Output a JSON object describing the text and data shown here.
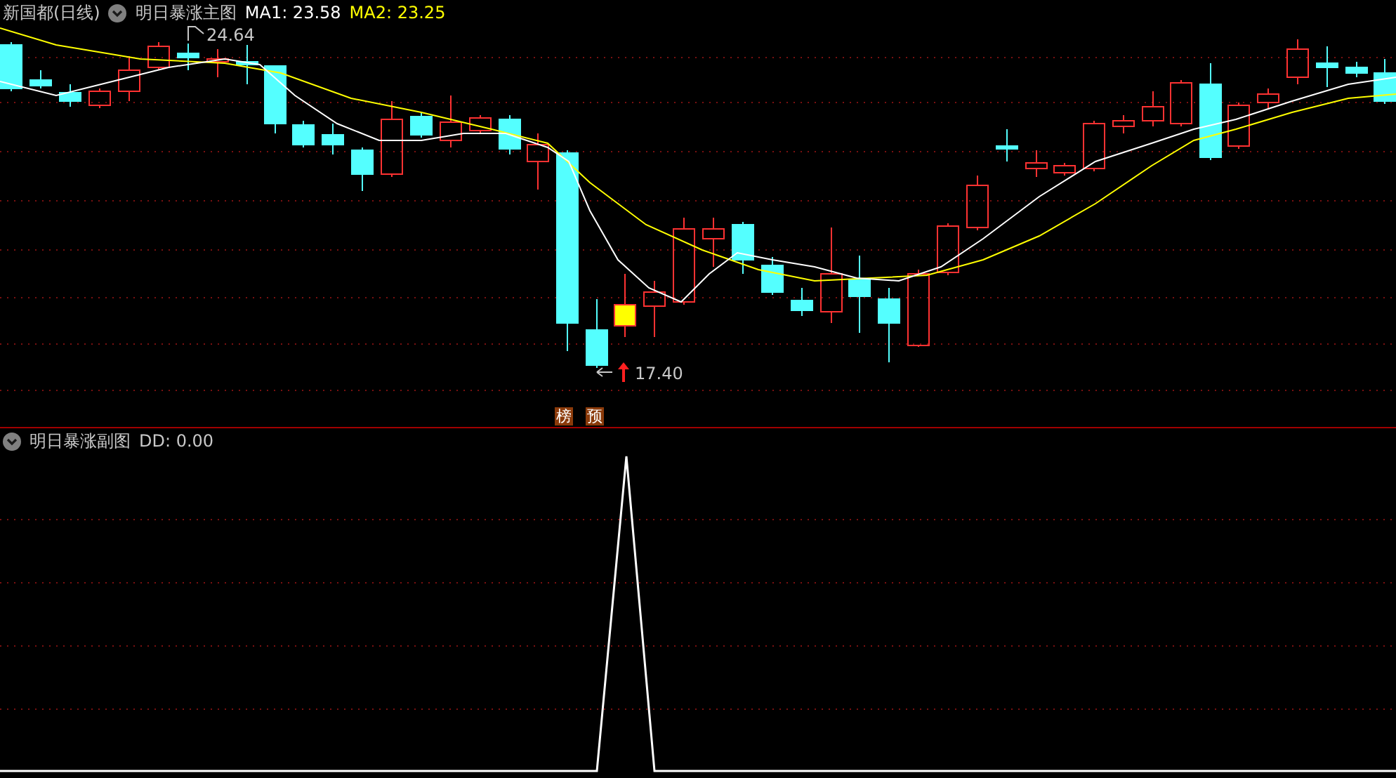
{
  "main_panel": {
    "title": "新国都(日线)",
    "indicator": "明日暴涨主图",
    "moving_averages": [
      {
        "label": "MA1: 23.58",
        "color": "#ffffff"
      },
      {
        "label": "MA2: 23.25",
        "color": "#ffff00"
      }
    ],
    "high_label": "24.64",
    "low_label": "17.40"
  },
  "signal_markers": [
    "榜",
    "预"
  ],
  "sub_panel": {
    "indicator": "明日暴涨副图",
    "value_label": "DD: 0.00"
  }
}
